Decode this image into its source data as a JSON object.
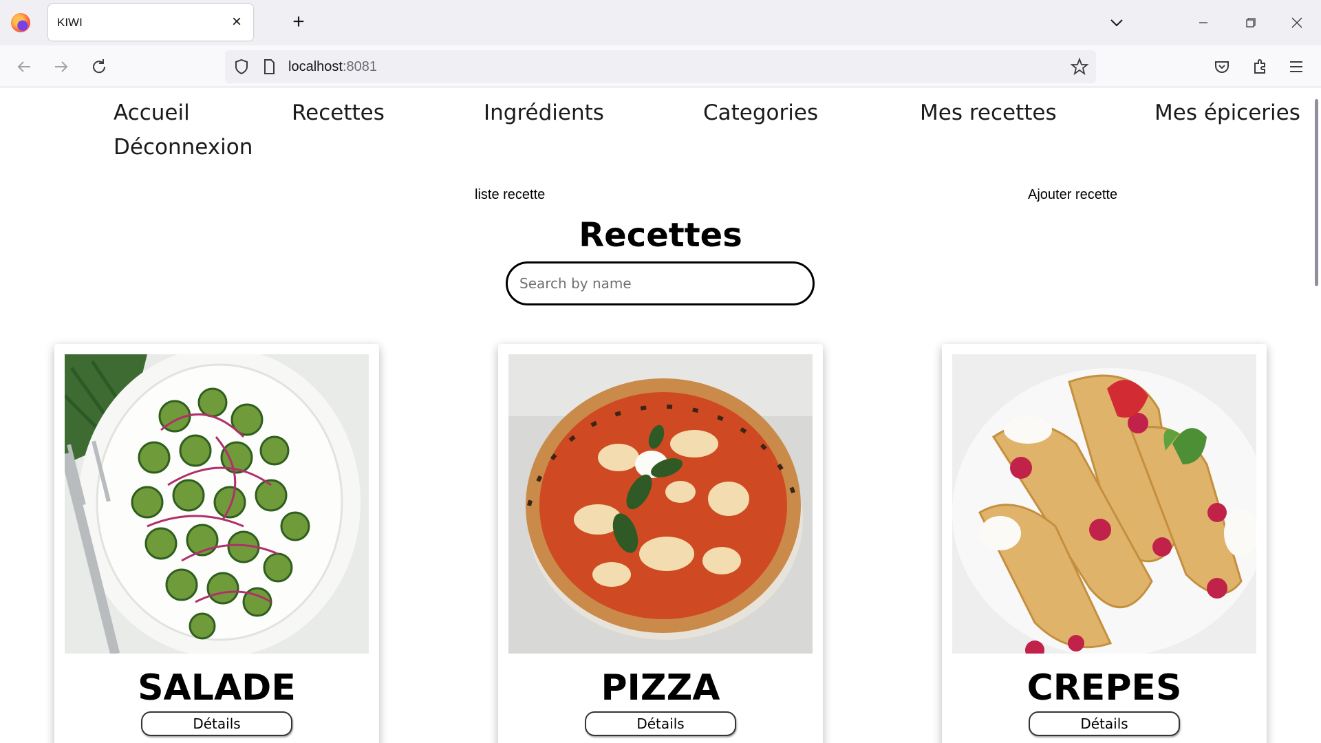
{
  "browser": {
    "tab_title": "KIWI",
    "url_host": "localhost",
    "url_port": ":8081",
    "icons": [
      "firefox-logo",
      "close-icon",
      "plus-icon",
      "chevron-down-icon",
      "minimize-icon",
      "restore-icon",
      "window-close-icon",
      "back-arrow-icon",
      "forward-arrow-icon",
      "reload-icon",
      "shield-icon",
      "page-icon",
      "star-icon",
      "pocket-icon",
      "extensions-icon",
      "menu-icon"
    ]
  },
  "site_nav": {
    "items": [
      "Accueil",
      "Recettes",
      "Ingrédients",
      "Categories",
      "Mes recettes",
      "Mes épiceries",
      "Déconnexion"
    ]
  },
  "sub_nav": {
    "list": "liste recette",
    "add": "Ajouter recette"
  },
  "main": {
    "title": "Recettes",
    "search_placeholder": "Search by name"
  },
  "recipes": [
    {
      "name": "SALADE",
      "button": "Détails",
      "image": "cucumber-onion-salad-photo"
    },
    {
      "name": "PIZZA",
      "button": "Détails",
      "image": "margherita-pizza-photo"
    },
    {
      "name": "CREPES",
      "button": "Détails",
      "image": "berry-crepes-photo"
    }
  ]
}
